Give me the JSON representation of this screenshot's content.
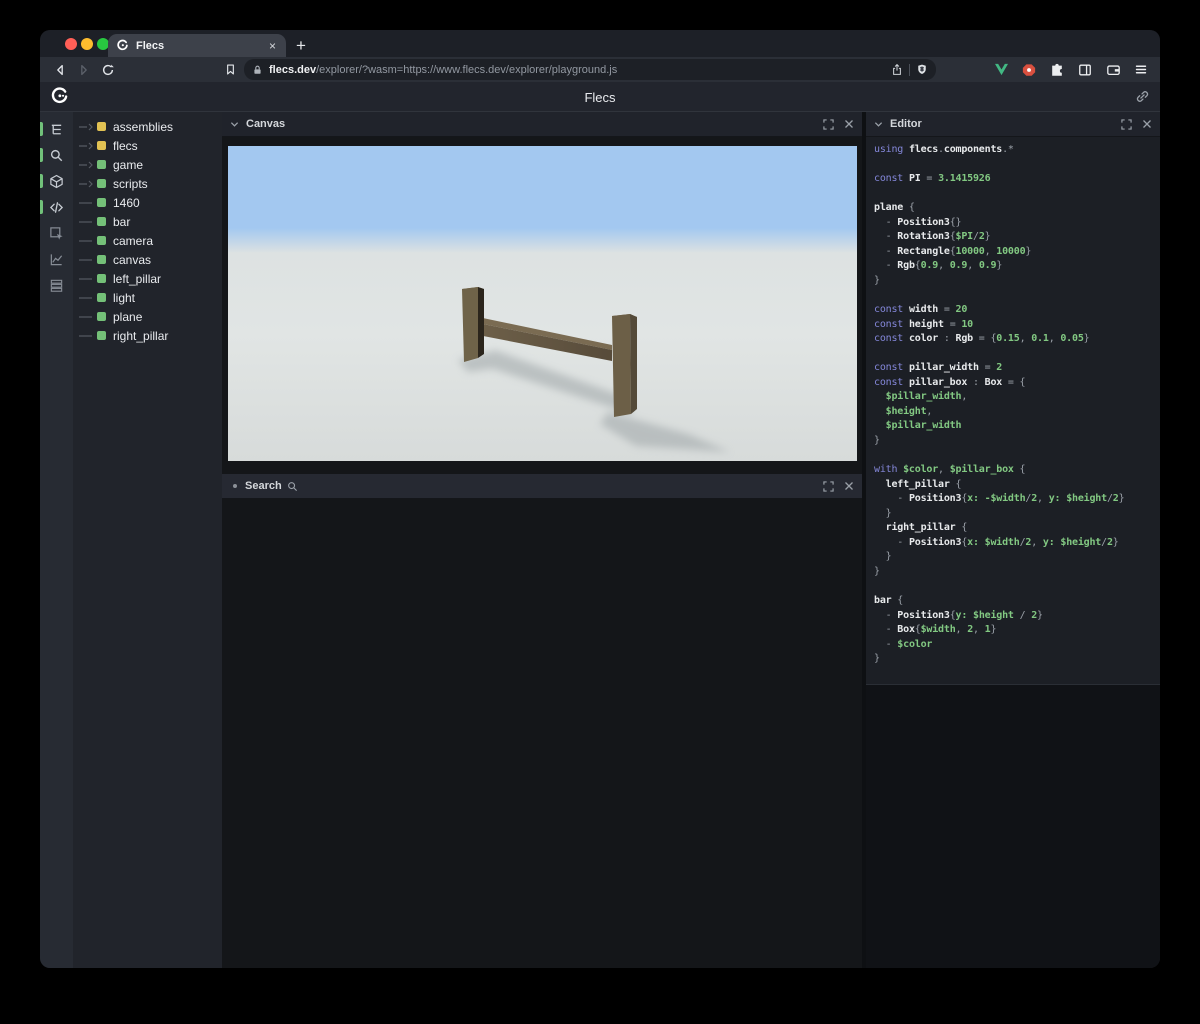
{
  "browser": {
    "traffic_lights": {
      "close": "#ff5f57",
      "minimize": "#febc2e",
      "zoom": "#28c840"
    },
    "tab": {
      "title": "Flecs",
      "close_glyph": "×",
      "new_tab_glyph": "+"
    },
    "url": {
      "domain": "flecs.dev",
      "path": "/explorer/?wasm=https://www.flecs.dev/explorer/playground.js"
    },
    "toolbar_icons": [
      "back-icon",
      "forward-icon",
      "reload-icon",
      "bookmark-icon",
      "lock-icon",
      "share-icon",
      "brave-shield-icon",
      "vue-devtools-icon",
      "adblock-icon",
      "extensions-puzzle-icon",
      "sidebar-icon",
      "wallet-icon",
      "menu-icon"
    ]
  },
  "header": {
    "title": "Flecs"
  },
  "rail": {
    "active_color": "#71c17a",
    "items": [
      {
        "icon": "entity-tree-icon",
        "active": true
      },
      {
        "icon": "search-icon",
        "active": true
      },
      {
        "icon": "cube-icon",
        "active": true
      },
      {
        "icon": "code-icon",
        "active": true
      },
      {
        "icon": "inspector-icon",
        "active": false
      },
      {
        "icon": "stats-icon",
        "active": false
      },
      {
        "icon": "data-icon",
        "active": false
      }
    ]
  },
  "tree": {
    "tag_colors": {
      "yellow": "#e2c253",
      "green": "#74c078"
    },
    "items": [
      {
        "label": "assemblies",
        "color": "yellow",
        "expandable": true
      },
      {
        "label": "flecs",
        "color": "yellow",
        "expandable": true
      },
      {
        "label": "game",
        "color": "green",
        "expandable": true
      },
      {
        "label": "scripts",
        "color": "green",
        "expandable": true
      },
      {
        "label": "1460",
        "color": "green",
        "expandable": false
      },
      {
        "label": "bar",
        "color": "green",
        "expandable": false
      },
      {
        "label": "camera",
        "color": "green",
        "expandable": false
      },
      {
        "label": "canvas",
        "color": "green",
        "expandable": false
      },
      {
        "label": "left_pillar",
        "color": "green",
        "expandable": false
      },
      {
        "label": "light",
        "color": "green",
        "expandable": false
      },
      {
        "label": "plane",
        "color": "green",
        "expandable": false
      },
      {
        "label": "right_pillar",
        "color": "green",
        "expandable": false
      }
    ]
  },
  "panels": {
    "canvas": {
      "title": "Canvas"
    },
    "search": {
      "title": "Search"
    },
    "editor": {
      "title": "Editor"
    }
  },
  "canvas": {
    "scene_colors": {
      "sky_top": "#a3c8f0",
      "horizon": "#dde2e2",
      "ground": "#e1e5e4",
      "ground_low": "#d7dbda",
      "shadow": "#9fa6a8",
      "lp_front": "#6f6349",
      "lp_side": "#2b251c",
      "lp_top": "#7b6d53",
      "rp_front": "#6c5f47",
      "rp_side": "#544a39",
      "rp_top": "#7d6e54",
      "bar_top": "#7a6b52",
      "bar_front_l": "#6e6049",
      "bar_front_r": "#574b3a"
    }
  },
  "editor_code": {
    "lines": [
      [
        [
          "k",
          "using "
        ],
        [
          "i",
          "flecs"
        ],
        [
          "p",
          "."
        ],
        [
          "i",
          "components"
        ],
        [
          "p",
          ".*"
        ]
      ],
      [],
      [
        [
          "k",
          "const "
        ],
        [
          "i",
          "PI"
        ],
        [
          "p",
          " = "
        ],
        [
          "v",
          "3.1415926"
        ]
      ],
      [],
      [
        [
          "i",
          "plane"
        ],
        [
          "p",
          " {"
        ]
      ],
      [
        [
          "p",
          "  - "
        ],
        [
          "i",
          "Position3"
        ],
        [
          "p",
          "{}"
        ]
      ],
      [
        [
          "p",
          "  - "
        ],
        [
          "i",
          "Rotation3"
        ],
        [
          "p",
          "{"
        ],
        [
          "v",
          "$PI"
        ],
        [
          "p",
          "/"
        ],
        [
          "v",
          "2"
        ],
        [
          "p",
          "}"
        ]
      ],
      [
        [
          "p",
          "  - "
        ],
        [
          "i",
          "Rectangle"
        ],
        [
          "p",
          "{"
        ],
        [
          "v",
          "10000"
        ],
        [
          "p",
          ", "
        ],
        [
          "v",
          "10000"
        ],
        [
          "p",
          "}"
        ]
      ],
      [
        [
          "p",
          "  - "
        ],
        [
          "i",
          "Rgb"
        ],
        [
          "p",
          "{"
        ],
        [
          "v",
          "0.9"
        ],
        [
          "p",
          ", "
        ],
        [
          "v",
          "0.9"
        ],
        [
          "p",
          ", "
        ],
        [
          "v",
          "0.9"
        ],
        [
          "p",
          "}"
        ]
      ],
      [
        [
          "p",
          "}"
        ]
      ],
      [],
      [
        [
          "k",
          "const "
        ],
        [
          "i",
          "width"
        ],
        [
          "p",
          " = "
        ],
        [
          "v",
          "20"
        ]
      ],
      [
        [
          "k",
          "const "
        ],
        [
          "i",
          "height"
        ],
        [
          "p",
          " = "
        ],
        [
          "v",
          "10"
        ]
      ],
      [
        [
          "k",
          "const "
        ],
        [
          "i",
          "color"
        ],
        [
          "p",
          " : "
        ],
        [
          "i",
          "Rgb"
        ],
        [
          "p",
          " = {"
        ],
        [
          "v",
          "0.15"
        ],
        [
          "p",
          ", "
        ],
        [
          "v",
          "0.1"
        ],
        [
          "p",
          ", "
        ],
        [
          "v",
          "0.05"
        ],
        [
          "p",
          "}"
        ]
      ],
      [],
      [
        [
          "k",
          "const "
        ],
        [
          "i",
          "pillar_width"
        ],
        [
          "p",
          " = "
        ],
        [
          "v",
          "2"
        ]
      ],
      [
        [
          "k",
          "const "
        ],
        [
          "i",
          "pillar_box"
        ],
        [
          "p",
          " : "
        ],
        [
          "i",
          "Box"
        ],
        [
          "p",
          " = {"
        ]
      ],
      [
        [
          "v",
          "  $pillar_width"
        ],
        [
          "p",
          ","
        ]
      ],
      [
        [
          "v",
          "  $height"
        ],
        [
          "p",
          ","
        ]
      ],
      [
        [
          "v",
          "  $pillar_width"
        ]
      ],
      [
        [
          "p",
          "}"
        ]
      ],
      [],
      [
        [
          "k",
          "with "
        ],
        [
          "v",
          "$color"
        ],
        [
          "p",
          ", "
        ],
        [
          "v",
          "$pillar_box"
        ],
        [
          "p",
          " {"
        ]
      ],
      [
        [
          "i",
          "  left_pillar"
        ],
        [
          "p",
          " {"
        ]
      ],
      [
        [
          "p",
          "    - "
        ],
        [
          "i",
          "Position3"
        ],
        [
          "p",
          "{"
        ],
        [
          "v",
          "x:"
        ],
        [
          "p",
          " "
        ],
        [
          "v",
          "-$width"
        ],
        [
          "p",
          "/"
        ],
        [
          "v",
          "2"
        ],
        [
          "p",
          ", "
        ],
        [
          "v",
          "y:"
        ],
        [
          "p",
          " "
        ],
        [
          "v",
          "$height"
        ],
        [
          "p",
          "/"
        ],
        [
          "v",
          "2"
        ],
        [
          "p",
          "}"
        ]
      ],
      [
        [
          "p",
          "  }"
        ]
      ],
      [
        [
          "i",
          "  right_pillar"
        ],
        [
          "p",
          " {"
        ]
      ],
      [
        [
          "p",
          "    - "
        ],
        [
          "i",
          "Position3"
        ],
        [
          "p",
          "{"
        ],
        [
          "v",
          "x:"
        ],
        [
          "p",
          " "
        ],
        [
          "v",
          "$width"
        ],
        [
          "p",
          "/"
        ],
        [
          "v",
          "2"
        ],
        [
          "p",
          ", "
        ],
        [
          "v",
          "y:"
        ],
        [
          "p",
          " "
        ],
        [
          "v",
          "$height"
        ],
        [
          "p",
          "/"
        ],
        [
          "v",
          "2"
        ],
        [
          "p",
          "}"
        ]
      ],
      [
        [
          "p",
          "  }"
        ]
      ],
      [
        [
          "p",
          "}"
        ]
      ],
      [],
      [
        [
          "i",
          "bar"
        ],
        [
          "p",
          " {"
        ]
      ],
      [
        [
          "p",
          "  - "
        ],
        [
          "i",
          "Position3"
        ],
        [
          "p",
          "{"
        ],
        [
          "v",
          "y:"
        ],
        [
          "p",
          " "
        ],
        [
          "v",
          "$height"
        ],
        [
          "p",
          " / "
        ],
        [
          "v",
          "2"
        ],
        [
          "p",
          "}"
        ]
      ],
      [
        [
          "p",
          "  - "
        ],
        [
          "i",
          "Box"
        ],
        [
          "p",
          "{"
        ],
        [
          "v",
          "$width"
        ],
        [
          "p",
          ", "
        ],
        [
          "v",
          "2"
        ],
        [
          "p",
          ", "
        ],
        [
          "v",
          "1"
        ],
        [
          "p",
          "}"
        ]
      ],
      [
        [
          "p",
          "  - "
        ],
        [
          "v",
          "$color"
        ]
      ],
      [
        [
          "p",
          "}"
        ]
      ]
    ]
  }
}
